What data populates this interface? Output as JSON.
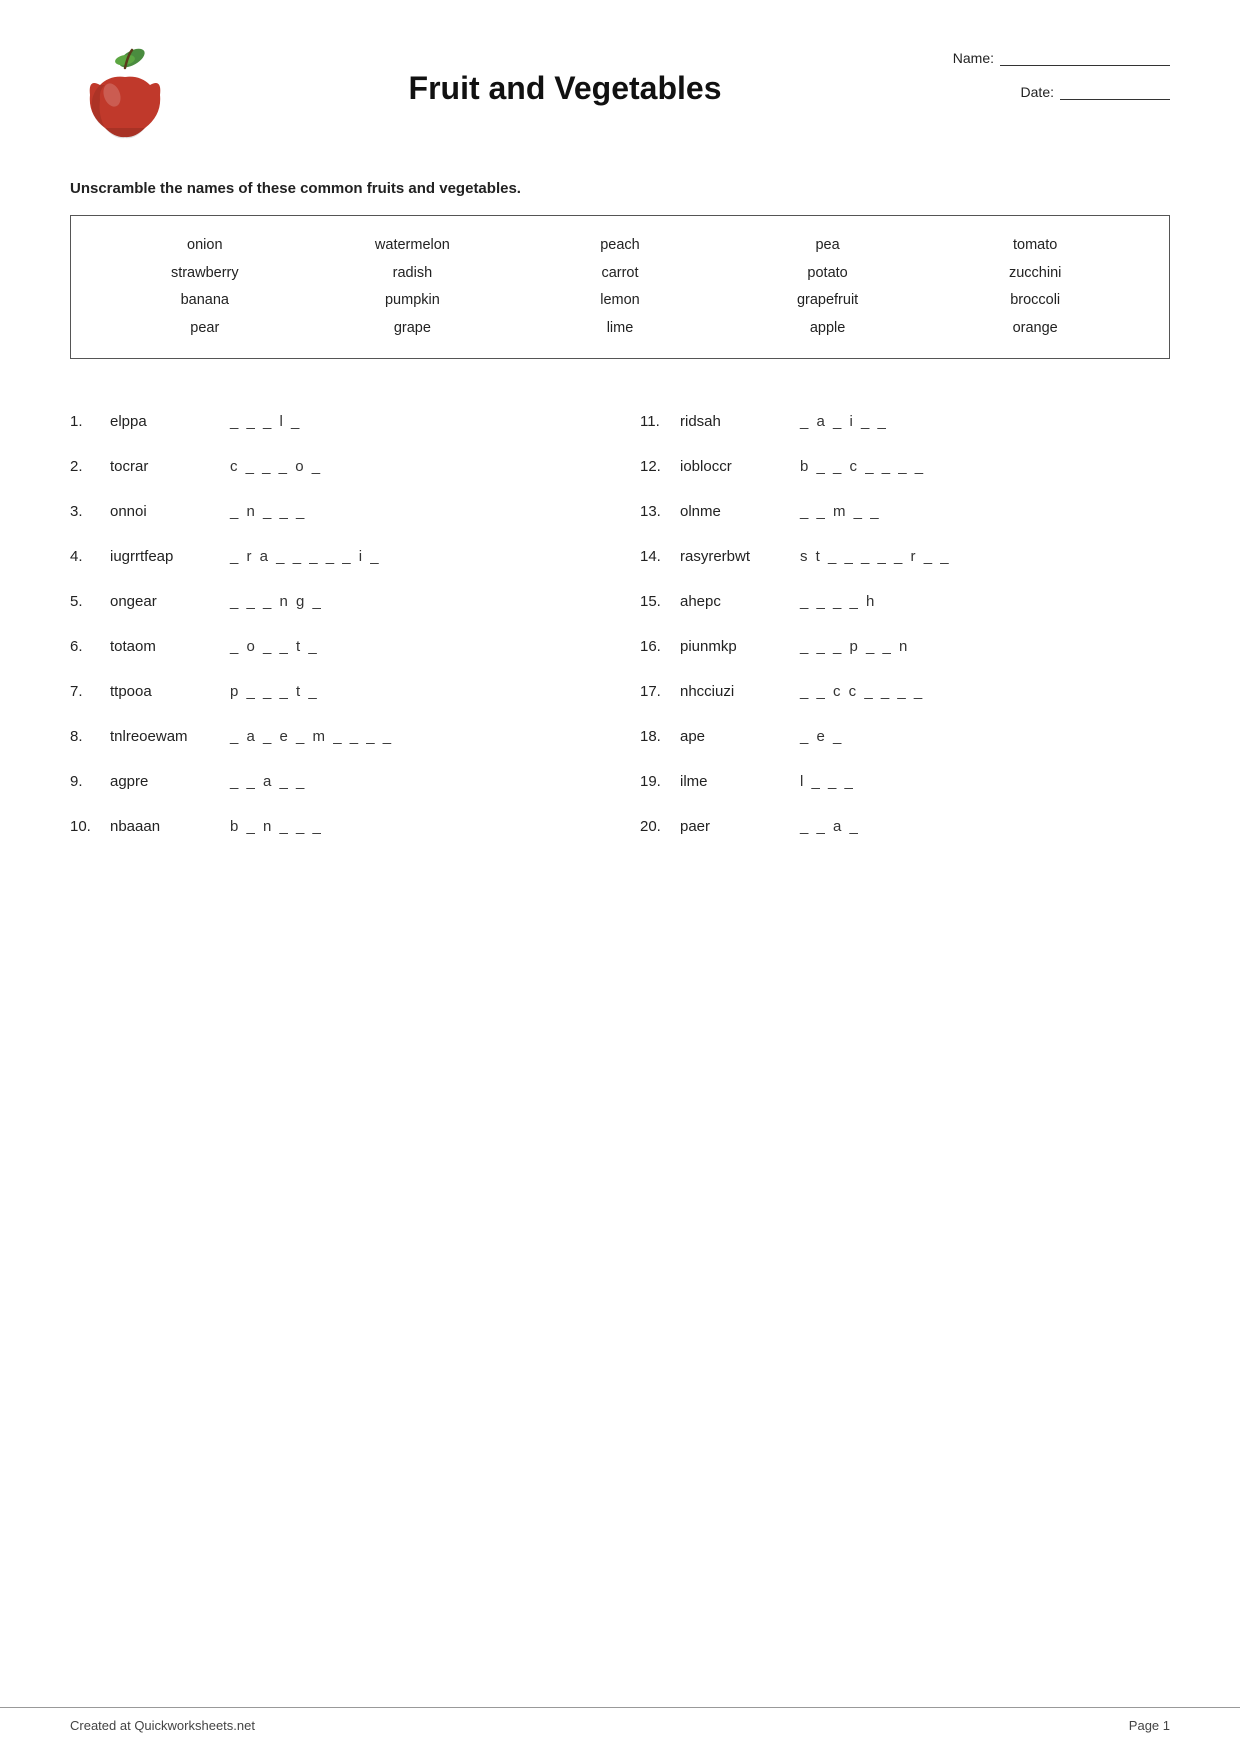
{
  "header": {
    "title": "Fruit and Vegetables",
    "name_label": "Name:",
    "date_label": "Date:"
  },
  "instructions": "Unscramble the names of these common fruits and vegetables.",
  "word_bank": {
    "columns": [
      [
        "onion",
        "strawberry",
        "banana",
        "pear"
      ],
      [
        "watermelon",
        "radish",
        "pumpkin",
        "grape"
      ],
      [
        "peach",
        "carrot",
        "lemon",
        "lime"
      ],
      [
        "pea",
        "potato",
        "grapefruit",
        "apple"
      ],
      [
        "tomato",
        "zucchini",
        "broccoli",
        "orange"
      ]
    ]
  },
  "questions": [
    {
      "num": "1.",
      "scrambled": "elppa",
      "answer": "_ _ _ l _"
    },
    {
      "num": "2.",
      "scrambled": "tocrar",
      "answer": "c _ _ _ o _"
    },
    {
      "num": "3.",
      "scrambled": "onnoi",
      "answer": "_ n _ _ _"
    },
    {
      "num": "4.",
      "scrambled": "iugrrtfeap",
      "answer": "_ r a _ _ _ _ _ i _"
    },
    {
      "num": "5.",
      "scrambled": "ongear",
      "answer": "_ _ _ n g _"
    },
    {
      "num": "6.",
      "scrambled": "totaom",
      "answer": "_ o _ _ t _"
    },
    {
      "num": "7.",
      "scrambled": "ttpooa",
      "answer": "p _ _ _ t _"
    },
    {
      "num": "8.",
      "scrambled": "tnlreoewam",
      "answer": "_ a _ e _ m _ _ _ _"
    },
    {
      "num": "9.",
      "scrambled": "agpre",
      "answer": "_ _ a _ _"
    },
    {
      "num": "10.",
      "scrambled": "nbaaan",
      "answer": "b _ n _ _ _"
    },
    {
      "num": "11.",
      "scrambled": "ridsah",
      "answer": "_ a _ i _ _"
    },
    {
      "num": "12.",
      "scrambled": "iobloccr",
      "answer": "b _ _ c _ _ _ _"
    },
    {
      "num": "13.",
      "scrambled": "olnme",
      "answer": "_ _ m _ _"
    },
    {
      "num": "14.",
      "scrambled": "rasyrerbwt",
      "answer": "s t _ _ _ _ _ r _ _"
    },
    {
      "num": "15.",
      "scrambled": "ahepc",
      "answer": "_ _ _ _ h"
    },
    {
      "num": "16.",
      "scrambled": "piunmkp",
      "answer": "_ _ _ p _ _ n"
    },
    {
      "num": "17.",
      "scrambled": "nhcciuzi",
      "answer": "_ _ c c _ _ _ _"
    },
    {
      "num": "18.",
      "scrambled": "ape",
      "answer": "_ e _"
    },
    {
      "num": "19.",
      "scrambled": "ilme",
      "answer": "l _ _ _"
    },
    {
      "num": "20.",
      "scrambled": "paer",
      "answer": "_ _ a _"
    }
  ],
  "footer": {
    "left": "Created at Quickworksheets.net",
    "right": "Page 1"
  }
}
